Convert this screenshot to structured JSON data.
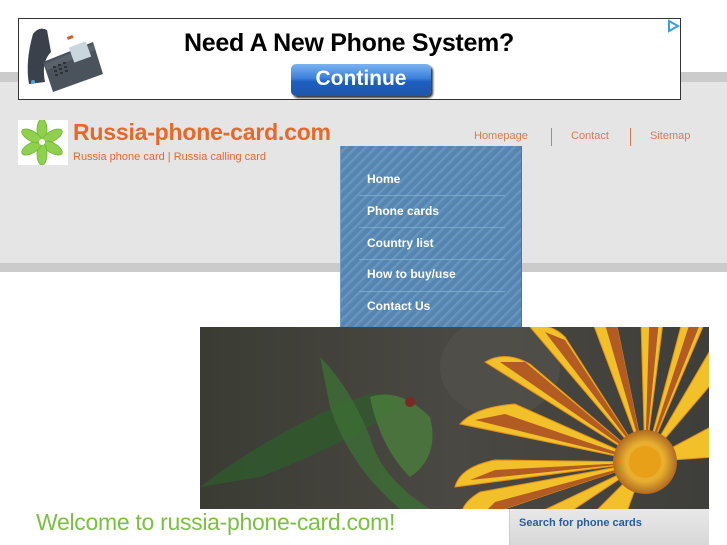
{
  "ad": {
    "headline": "Need A New Phone System?",
    "button_label": "Continue",
    "choices_icon": "adchoices-triangle-icon",
    "accent_color": "#1d5fc0"
  },
  "site": {
    "title": "Russia-phone-card.com",
    "tagline": "Russia phone card | Russia calling card",
    "brand_color": "#e8682a"
  },
  "top_links": [
    {
      "label": "Homepage"
    },
    {
      "label": "Contact"
    },
    {
      "label": "Sitemap"
    }
  ],
  "menu": {
    "items": [
      {
        "label": "Home"
      },
      {
        "label": "Phone cards"
      },
      {
        "label": "Country list"
      },
      {
        "label": "How to buy/use"
      },
      {
        "label": "Contact Us"
      }
    ],
    "color": "#5585b0"
  },
  "main": {
    "welcome": "Welcome to russia-phone-card.com!",
    "welcome_color": "#7ac142"
  },
  "sidebar": {
    "search_title": "Search for phone cards"
  }
}
